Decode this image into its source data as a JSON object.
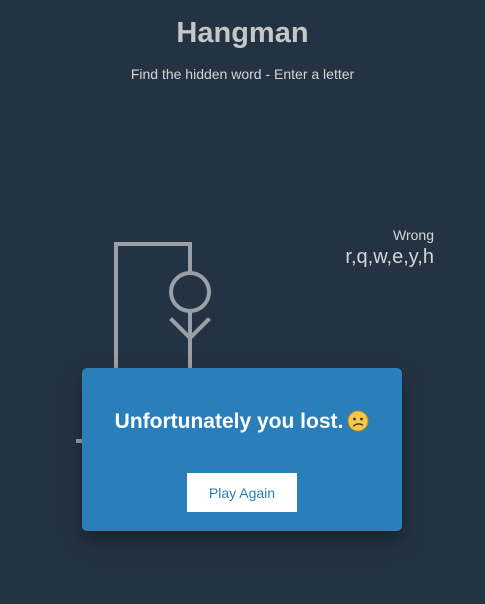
{
  "header": {
    "title": "Hangman",
    "subtitle": "Find the hidden word - Enter a letter"
  },
  "wrong": {
    "label": "Wrong",
    "letters": "r,q,w,e,y,h"
  },
  "popup": {
    "message": "Unfortunately you lost.",
    "emoji": "confused-face-icon",
    "button_label": "Play Again"
  },
  "colors": {
    "background": "#243343",
    "popup": "#2a7eb9",
    "figure": "#9aa0a6",
    "text": "#d4d4d4"
  }
}
